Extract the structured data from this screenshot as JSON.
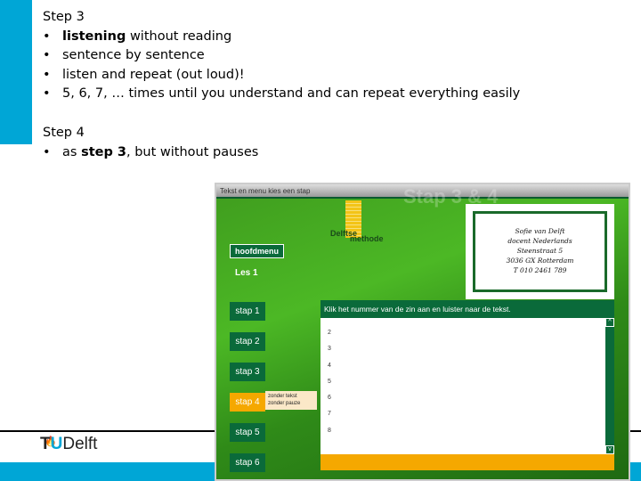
{
  "slide": {
    "step3_title": "Step 3",
    "step3_items": [
      {
        "bold": "listening",
        "rest": " without reading"
      },
      {
        "bold": "",
        "rest": "sentence by sentence"
      },
      {
        "bold": "",
        "rest": "listen and repeat (out loud)!"
      },
      {
        "bold": "",
        "rest": "5, 6, 7, … times until you understand and can repeat everything easily"
      }
    ],
    "step4_title": "Step 4",
    "step4_item_pre": "as ",
    "step4_item_bold": "step 3",
    "step4_item_post": ", but without pauses"
  },
  "footer": {
    "logo_t": "T",
    "logo_u": "U",
    "logo_rest": "Delft"
  },
  "app": {
    "window_title": "Tekst en menu kies een stap",
    "header_title": "Stap 3 & 4",
    "brand_1": "Delftse",
    "brand_2": "methode",
    "main_menu": "hoofdmenu",
    "lesson": "Les 1",
    "card": [
      "Sofie van Delft",
      "docent Nederlands",
      "Steenstraat 5",
      "3036 GX Rotterdam",
      "T 010 2461 789"
    ],
    "steps": [
      "stap 1",
      "stap 2",
      "stap 3",
      "stap 4",
      "stap 5",
      "stap 6"
    ],
    "active_step": "stap 4",
    "step_note": [
      "zonder tekst",
      "zonder pauze"
    ],
    "instruction": "Klik het nummer van de zin aan en luister naar de tekst.",
    "sentences": [
      "2",
      "3",
      "4",
      "5",
      "6",
      "7",
      "8"
    ],
    "scroll_up": "^",
    "scroll_down": "v",
    "colors": {
      "green": "#0a6a3a",
      "orange": "#f5a800",
      "tu_blue": "#00a6d6"
    }
  }
}
